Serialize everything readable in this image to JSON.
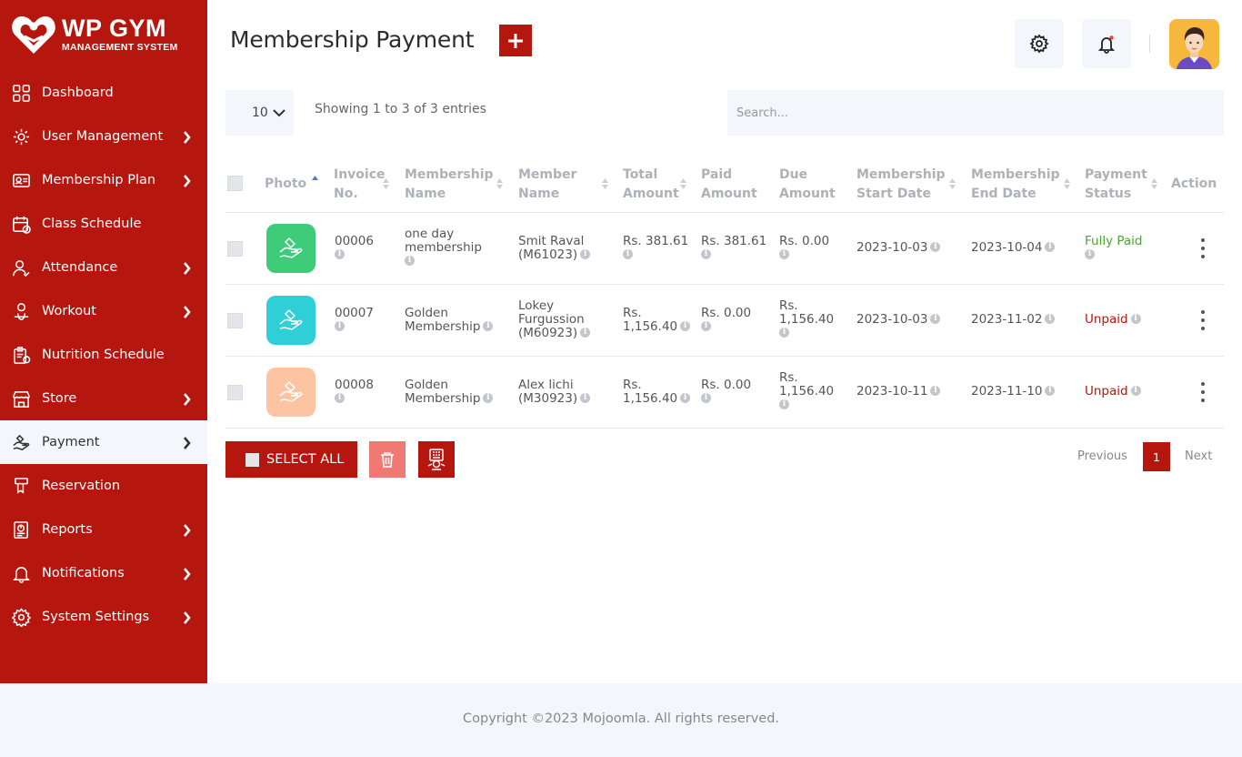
{
  "brand": {
    "title": "WP GYM",
    "subtitle": "MANAGEMENT SYSTEM"
  },
  "sidebar": {
    "items": [
      {
        "label": "Dashboard",
        "icon": "grid-icon",
        "has_submenu": false
      },
      {
        "label": "User Management",
        "icon": "users-gear-icon",
        "has_submenu": true
      },
      {
        "label": "Membership Plan",
        "icon": "id-card-icon",
        "has_submenu": true
      },
      {
        "label": "Class Schedule",
        "icon": "calendar-icon",
        "has_submenu": false
      },
      {
        "label": "Attendance",
        "icon": "user-check-icon",
        "has_submenu": true
      },
      {
        "label": "Workout",
        "icon": "workout-icon",
        "has_submenu": true
      },
      {
        "label": "Nutrition Schedule",
        "icon": "clipboard-icon",
        "has_submenu": false
      },
      {
        "label": "Store",
        "icon": "store-icon",
        "has_submenu": true
      },
      {
        "label": "Payment",
        "icon": "payment-hand-icon",
        "has_submenu": true,
        "active": true
      },
      {
        "label": "Reservation",
        "icon": "reservation-icon",
        "has_submenu": false
      },
      {
        "label": "Reports",
        "icon": "report-icon",
        "has_submenu": true
      },
      {
        "label": "Notifications",
        "icon": "bell-icon",
        "has_submenu": true
      },
      {
        "label": "System Settings",
        "icon": "gear-icon",
        "has_submenu": true
      }
    ]
  },
  "header": {
    "title": "Membership Payment"
  },
  "controls": {
    "page_length": "10",
    "info": "Showing 1 to 3 of 3 entries",
    "search_placeholder": "Search..."
  },
  "table": {
    "headers": {
      "photo": "Photo",
      "invoice_1": "Invoice",
      "invoice_2": "No.",
      "mname_1": "Membership",
      "mname_2": "Name",
      "member_1": "Member",
      "member_2": "Name",
      "total_1": "Total",
      "total_2": "Amount",
      "paid_1": "Paid",
      "paid_2": "Amount",
      "due_1": "Due",
      "due_2": "Amount",
      "start_1": "Membership",
      "start_2": "Start Date",
      "end_1": "Membership",
      "end_2": "End Date",
      "status_1": "Payment",
      "status_2": "Status",
      "action": "Action"
    },
    "rows": [
      {
        "photo_color": "#3ecb7a",
        "invoice": "00006",
        "membership_1": "one day",
        "membership_2": "membership",
        "member_1": "Smit Raval",
        "member_2": "(M61023)",
        "total_1": "Rs. 381.61",
        "total_2": "",
        "paid": "Rs. 381.61",
        "due_1": "Rs. 0.00",
        "due_2": "",
        "start": "2023-10-03",
        "end": "2023-10-04",
        "status": "Fully Paid",
        "status_type": "paid"
      },
      {
        "photo_color": "#2fcfd8",
        "invoice": "00007",
        "membership_1": "Golden",
        "membership_2": "Membership",
        "member_1": "Lokey",
        "member_2": "Furgussion",
        "member_3": "(M60923)",
        "total_1": "Rs.",
        "total_2": "1,156.40",
        "paid": "Rs. 0.00",
        "due_1": "Rs.",
        "due_2": "1,156.40",
        "start": "2023-10-03",
        "end": "2023-11-02",
        "status": "Unpaid",
        "status_type": "unpaid"
      },
      {
        "photo_color": "#fdc4a4",
        "invoice": "00008",
        "membership_1": "Golden",
        "membership_2": "Membership",
        "member_1": "Alex lichi",
        "member_2": "(M30923)",
        "total_1": "Rs.",
        "total_2": "1,156.40",
        "paid": "Rs. 0.00",
        "due_1": "Rs.",
        "due_2": "1,156.40",
        "start": "2023-10-11",
        "end": "2023-11-10",
        "status": "Unpaid",
        "status_type": "unpaid"
      }
    ]
  },
  "actions": {
    "select_all": "SELECT ALL"
  },
  "pagination": {
    "previous": "Previous",
    "current": "1",
    "next": "Next"
  },
  "footer": {
    "text": "Copyright ©2023 Mojoomla. All rights reserved."
  },
  "colors": {
    "brand": "#b5160e",
    "paid": "#4aa532",
    "unpaid": "#b5160e",
    "panel": "#f3f6fb"
  }
}
